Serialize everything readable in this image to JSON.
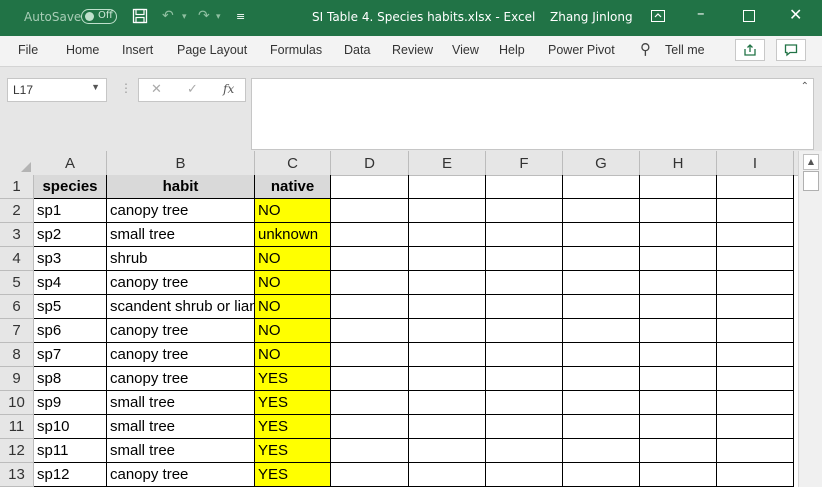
{
  "window": {
    "autosave_label": "AutoSave",
    "autosave_state": "Off",
    "doc_title": "SI Table 4. Species habits.xlsx  -  Excel",
    "user": "Zhang Jinlong"
  },
  "ribbon": {
    "tabs": [
      "File",
      "Home",
      "Insert",
      "Page Layout",
      "Formulas",
      "Data",
      "Review",
      "View",
      "Help",
      "Power Pivot"
    ],
    "tell_me": "Tell me"
  },
  "formula_bar": {
    "name_box": "L17",
    "formula": ""
  },
  "sheet": {
    "columns": [
      "A",
      "B",
      "C",
      "D",
      "E",
      "F",
      "G",
      "H",
      "I"
    ],
    "headers": [
      "species",
      "habit",
      "native"
    ],
    "rows": [
      {
        "num": "1"
      },
      {
        "num": "2",
        "species": "sp1",
        "habit": "canopy tree",
        "native": "NO"
      },
      {
        "num": "3",
        "species": "sp2",
        "habit": "small tree",
        "native": "unknown"
      },
      {
        "num": "4",
        "species": "sp3",
        "habit": "shrub",
        "native": "NO"
      },
      {
        "num": "5",
        "species": "sp4",
        "habit": "canopy tree",
        "native": "NO"
      },
      {
        "num": "6",
        "species": "sp5",
        "habit": "scandent shrub or liana",
        "native": "NO"
      },
      {
        "num": "7",
        "species": "sp6",
        "habit": "canopy tree",
        "native": "NO"
      },
      {
        "num": "8",
        "species": "sp7",
        "habit": "canopy tree",
        "native": "NO"
      },
      {
        "num": "9",
        "species": "sp8",
        "habit": "canopy tree",
        "native": "YES"
      },
      {
        "num": "10",
        "species": "sp9",
        "habit": "small tree",
        "native": "YES"
      },
      {
        "num": "11",
        "species": "sp10",
        "habit": "small tree",
        "native": "YES"
      },
      {
        "num": "12",
        "species": "sp11",
        "habit": "small tree",
        "native": "YES"
      },
      {
        "num": "13",
        "species": "sp12",
        "habit": "canopy tree",
        "native": "YES"
      }
    ]
  },
  "colors": {
    "titlebar": "#217346",
    "native_highlight": "#ffff00",
    "header_fill": "#d9d9d9"
  }
}
